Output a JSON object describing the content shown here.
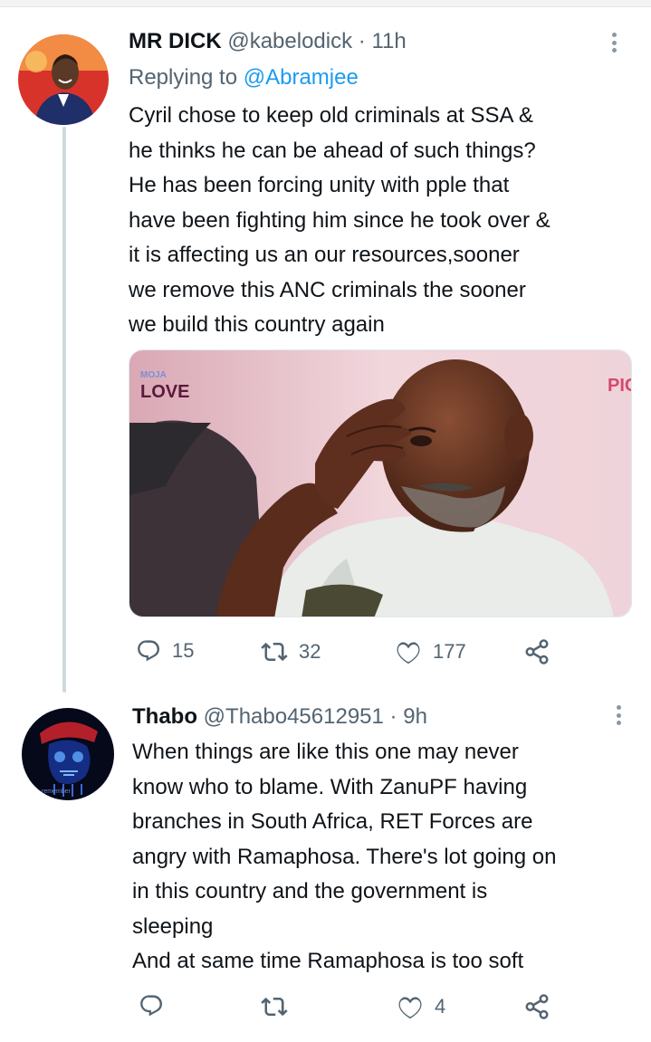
{
  "tweets": [
    {
      "display_name": "MR DICK",
      "handle": "@kabelodick",
      "separator": "·",
      "time": "11h",
      "replying_prefix": "Replying to",
      "replying_to": "@Abramjee",
      "text_lines": [
        "Cyril chose to keep old criminals at SSA &",
        "he thinks he can be ahead of such things?",
        "He has been forcing unity with pple that",
        "have been fighting him since he took over &",
        "it is affecting us an our resources,sooner",
        "we remove this ANC criminals the sooner",
        "we build this country again"
      ],
      "media": {
        "watermark_top": "MOJA",
        "watermark_bottom": "LOVE",
        "corner_text": "PIG"
      },
      "actions": {
        "reply_icon": "reply-icon",
        "reply_count": "15",
        "retweet_icon": "retweet-icon",
        "retweet_count": "32",
        "like_icon": "heart-icon",
        "like_count": "177",
        "share_icon": "share-icon"
      }
    },
    {
      "display_name": "Thabo",
      "handle": "@Thabo45612951",
      "separator": "·",
      "time": "9h",
      "avatar_caption": "remember",
      "text_lines": [
        "When things are like this one may never",
        "know  who to blame. With ZanuPF having",
        "branches in South Africa, RET Forces are",
        "angry with Ramaphosa. There's lot going on",
        "in this country and the government is",
        "sleeping",
        "And at same time Ramaphosa is too soft"
      ],
      "actions": {
        "reply_icon": "reply-icon",
        "retweet_icon": "retweet-icon",
        "like_icon": "heart-icon",
        "like_count": "4",
        "share_icon": "share-icon"
      }
    }
  ],
  "colors": {
    "accent": "#1d9bf0",
    "secondary_text": "#536471",
    "primary_text": "#0f1419",
    "thread_line": "#cfd9de"
  }
}
